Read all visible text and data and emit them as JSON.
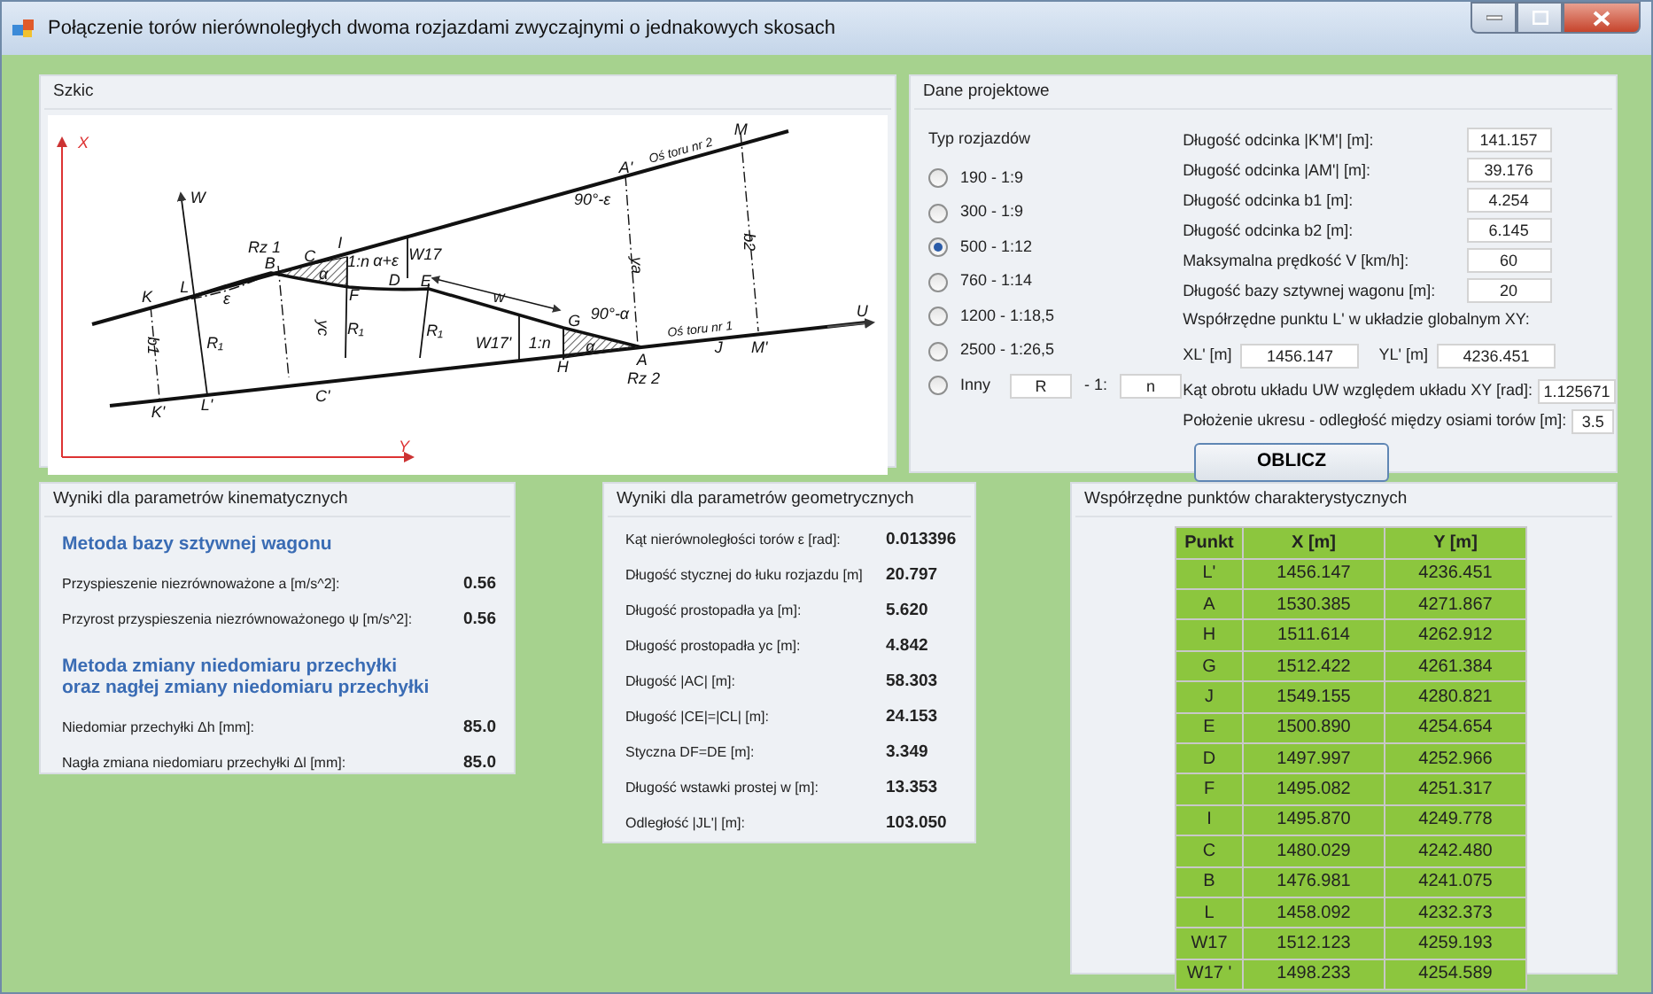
{
  "window": {
    "title": "Połączenie torów nierównoległych dwoma rozjazdami zwyczajnymi o jednakowych skosach"
  },
  "sketch": {
    "title": "Szkic",
    "labels": [
      "X",
      "Y",
      "W",
      "U",
      "K",
      "L",
      "ε",
      "Rz 1",
      "B",
      "C",
      "I",
      "1:n",
      "α+ε",
      "W17",
      "α",
      "F",
      "D",
      "E",
      "w",
      "G",
      "90°-α",
      "90°-ε",
      "A'",
      "Oś toru nr 2",
      "M",
      "b2",
      "ya",
      "yc",
      "b1",
      "R₁",
      "R₁",
      "R₁",
      "W17'",
      "1:n",
      "α",
      "H",
      "A",
      "Rz 2",
      "Oś toru nr 1",
      "J",
      "M'",
      "K'",
      "L'",
      "C'"
    ]
  },
  "project": {
    "title": "Dane projektowe",
    "turnout_label": "Typ rozjazdów",
    "options": [
      {
        "kind": "preset",
        "label": "190 - 1:9",
        "selected": false
      },
      {
        "kind": "preset",
        "label": "300 - 1:9",
        "selected": false
      },
      {
        "kind": "preset",
        "label": "500 - 1:12",
        "selected": true
      },
      {
        "kind": "preset",
        "label": "760 - 1:14",
        "selected": false
      },
      {
        "kind": "preset",
        "label": "1200 - 1:18,5",
        "selected": false
      },
      {
        "kind": "preset",
        "label": "2500 - 1:26,5",
        "selected": false
      },
      {
        "kind": "custom",
        "label": "Inny",
        "selected": false,
        "radius": "R",
        "separator": "- 1:",
        "ratio": "n"
      }
    ],
    "fields": [
      {
        "label": "Długość odcinka |K'M'| [m]:",
        "value": "141.157"
      },
      {
        "label": "Długość odcinka |AM'| [m]:",
        "value": "39.176"
      },
      {
        "label": "Długość odcinka b1 [m]:",
        "value": "4.254"
      },
      {
        "label": "Długość odcinka b2 [m]:",
        "value": "6.145"
      },
      {
        "label": "Maksymalna prędkość V [km/h]:",
        "value": "60"
      },
      {
        "label": "Długość bazy sztywnej wagonu [m]:",
        "value": "20"
      }
    ],
    "global_point": {
      "label": "Współrzędne punktu L' w układzie globalnym XY:",
      "x_label": "XL' [m]",
      "x_value": "1456.147",
      "y_label": "YL' [m]",
      "y_value": "4236.451"
    },
    "extra_fields": [
      {
        "label": "Kąt obrotu układu UW względem układu XY [rad]:",
        "value": "1.125671"
      },
      {
        "label": "Położenie ukresu - odległość między osiami torów [m]:",
        "value": "3.5"
      }
    ],
    "button": "OBLICZ"
  },
  "kinematic": {
    "title": "Wyniki dla parametrów kinematycznych",
    "sections": [
      {
        "heading": "Metoda bazy sztywnej wagonu",
        "rows": [
          {
            "label": "Przyspieszenie niezrównoważone a [m/s^2]:",
            "value": "0.56"
          },
          {
            "label": "Przyrost przyspieszenia niezrównoważonego ψ [m/s^2]:",
            "value": "0.56"
          }
        ]
      },
      {
        "heading": "Metoda zmiany niedomiaru przechyłki\noraz nagłej zmiany niedomiaru przechyłki",
        "rows": [
          {
            "label": "Niedomiar przechyłki Δh [mm]:",
            "value": "85.0"
          },
          {
            "label": "Nagła zmiana niedomiaru przechyłki Δl [mm]:",
            "value": "85.0"
          }
        ]
      }
    ]
  },
  "geometric": {
    "title": "Wyniki dla parametrów geometrycznych",
    "rows": [
      {
        "label": "Kąt nierównoległości torów ε [rad]:",
        "value": "0.013396"
      },
      {
        "label": "Długość stycznej do łuku rozjazdu [m]",
        "value": "20.797"
      },
      {
        "label": "Długość prostopadła ya [m]:",
        "value": "5.620"
      },
      {
        "label": "Długość prostopadła yc [m]:",
        "value": "4.842"
      },
      {
        "label": "Długość |AC| [m]:",
        "value": "58.303"
      },
      {
        "label": "Długość |CE|=|CL| [m]:",
        "value": "24.153"
      },
      {
        "label": "Styczna DF=DE [m]:",
        "value": "3.349"
      },
      {
        "label": "Długość wstawki prostej w [m]:",
        "value": "13.353"
      },
      {
        "label": "Odległość |JL'| [m]:",
        "value": "103.050"
      }
    ]
  },
  "coordinates": {
    "title": "Współrzędne punktów charakterystycznych",
    "columns": [
      "Punkt",
      "X [m]",
      "Y [m]"
    ],
    "rows": [
      [
        "L'",
        "1456.147",
        "4236.451"
      ],
      [
        "A",
        "1530.385",
        "4271.867"
      ],
      [
        "H",
        "1511.614",
        "4262.912"
      ],
      [
        "G",
        "1512.422",
        "4261.384"
      ],
      [
        "J",
        "1549.155",
        "4280.821"
      ],
      [
        "E",
        "1500.890",
        "4254.654"
      ],
      [
        "D",
        "1497.997",
        "4252.966"
      ],
      [
        "F",
        "1495.082",
        "4251.317"
      ],
      [
        "I",
        "1495.870",
        "4249.778"
      ],
      [
        "C",
        "1480.029",
        "4242.480"
      ],
      [
        "B",
        "1476.981",
        "4241.075"
      ],
      [
        "L",
        "1458.092",
        "4232.373"
      ],
      [
        "W17",
        "1512.123",
        "4259.193"
      ],
      [
        "W17 '",
        "1498.233",
        "4254.589"
      ]
    ]
  }
}
